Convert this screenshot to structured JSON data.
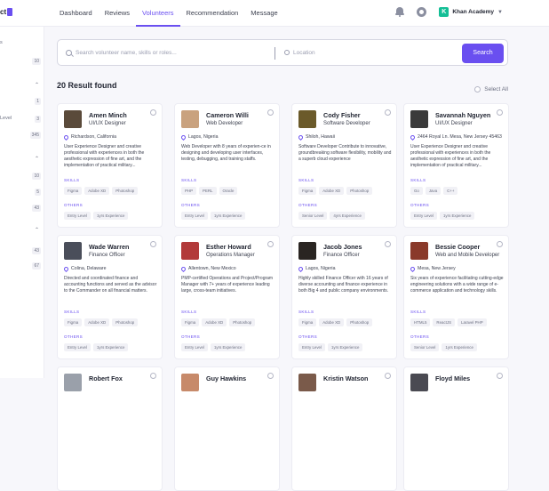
{
  "brand": {
    "label": "ct"
  },
  "nav": [
    "Dashboard",
    "Reviews",
    "Volunteers",
    "Recommendation",
    "Message"
  ],
  "org": {
    "name": "Khan Academy",
    "logo": "K"
  },
  "sidebar": {
    "items": [
      {
        "label": "s"
      },
      {
        "num": "10"
      },
      {
        "label": "Level"
      },
      {
        "num": "3"
      },
      {
        "num": "345"
      },
      {
        "num": "10"
      },
      {
        "num": "5"
      },
      {
        "num": "43"
      },
      {
        "num": "43"
      },
      {
        "num": "67"
      }
    ]
  },
  "search": {
    "placeholder": "Search volunteer name, skills or roles...",
    "location_placeholder": "Location",
    "button": "Search"
  },
  "results_label": "20 Result found",
  "select_all": "Select All",
  "section_labels": {
    "skills": "SKILLS",
    "others": "OTHERS"
  },
  "cards": [
    {
      "name": "Amen Minch",
      "title": "UI/UX Designer",
      "location": "Richardson, California",
      "desc": "User Experience Designer and creative professional with experiences in both the aesthetic expression of fine art, and the implementation of practical military...",
      "skills": [
        "Figma",
        "Adobe XD",
        "Photoshop"
      ],
      "others": [
        "Entry Level",
        "1yrs Experience"
      ],
      "avatar_color": "#5a4a3a"
    },
    {
      "name": "Cameron Willi",
      "title": "Web Developer",
      "location": "Lagos, Nigeria",
      "desc": "Web Developer with 8 years of experien-ce in designing and developing user interfaces, testing, debugging, and training staffs.",
      "skills": [
        "PHP",
        "PERL",
        "Oracle"
      ],
      "others": [
        "Entry Level",
        "1yrs Experience"
      ],
      "avatar_color": "#c9a27e"
    },
    {
      "name": "Cody Fisher",
      "title": "Software Developer",
      "location": "Shiloh, Hawaii",
      "desc": "Software Developer Contribute to innovative, groundbreaking software flexibility, mobility and a superb cloud experience",
      "skills": [
        "Figma",
        "Adobe XD",
        "Photoshop"
      ],
      "others": [
        "Senior Level",
        "4yrs Experience"
      ],
      "avatar_color": "#6b5a2a"
    },
    {
      "name": "Savannah Nguyen",
      "title": "UI/UX Designer",
      "location": "2464 Royal Ln. Mesa, New Jersey 45463",
      "desc": "User Experience Designer and creative professional with experiences in both the aesthetic expression of fine art, and the implementation of practical military...",
      "skills": [
        "Go",
        "Java",
        "C++"
      ],
      "others": [
        "Entry Level",
        "1yrs Experience"
      ],
      "avatar_color": "#3a3a3a"
    },
    {
      "name": "Wade Warren",
      "title": "Finance Officer",
      "location": "Colina, Delaware",
      "desc": "Directed and coordinated finance and accounting functions and served as the advisor to the Commander on all financial matters.",
      "skills": [
        "Figma",
        "Adobe XD",
        "Photoshop"
      ],
      "others": [
        "Entry Level",
        "1yrs Experience"
      ],
      "avatar_color": "#4a4e5a"
    },
    {
      "name": "Esther Howard",
      "title": "Operations Manager",
      "location": "Allentown, New Mexico",
      "desc": "PMP-certified Operations and Project/Program Manager with 7+ years of experience leading large, cross-team initiatives.",
      "skills": [
        "Figma",
        "Adobe XD",
        "Photoshop"
      ],
      "others": [
        "Entry Level",
        "1yrs Experience"
      ],
      "avatar_color": "#b23a3a"
    },
    {
      "name": "Jacob Jones",
      "title": "Finance Officer",
      "location": "Lagos, Nigeria",
      "desc": "Highly skilled Finance Officer with 16 years of diverse accounting and finance experience in both Big 4 and public company environments.",
      "skills": [
        "Figma",
        "Adobe XD",
        "Photoshop"
      ],
      "others": [
        "Entry Level",
        "1yrs Experience"
      ],
      "avatar_color": "#2a2522"
    },
    {
      "name": "Bessie Cooper",
      "title": "Web and Mobile Developer",
      "location": "Mesa, New Jersey",
      "desc": "Six years of experience facilitating cutting-edge engineering solutions with a wide range of e-commerce application and technology skills.",
      "skills": [
        "HTML5",
        "ReactJS",
        "Laravel PHP"
      ],
      "others": [
        "Senior Level",
        "1yrs Experience"
      ],
      "avatar_color": "#8a3a2a"
    },
    {
      "name": "Robert Fox",
      "title": "",
      "location": "",
      "desc": "",
      "skills": [],
      "others": [],
      "avatar_color": "#9aa0aa"
    },
    {
      "name": "Guy Hawkins",
      "title": "",
      "location": "",
      "desc": "",
      "skills": [],
      "others": [],
      "avatar_color": "#c78a6a"
    },
    {
      "name": "Kristin Watson",
      "title": "",
      "location": "",
      "desc": "",
      "skills": [],
      "others": [],
      "avatar_color": "#7a5a4a"
    },
    {
      "name": "Floyd Miles",
      "title": "",
      "location": "",
      "desc": "",
      "skills": [],
      "others": [],
      "avatar_color": "#4a4a52"
    }
  ]
}
